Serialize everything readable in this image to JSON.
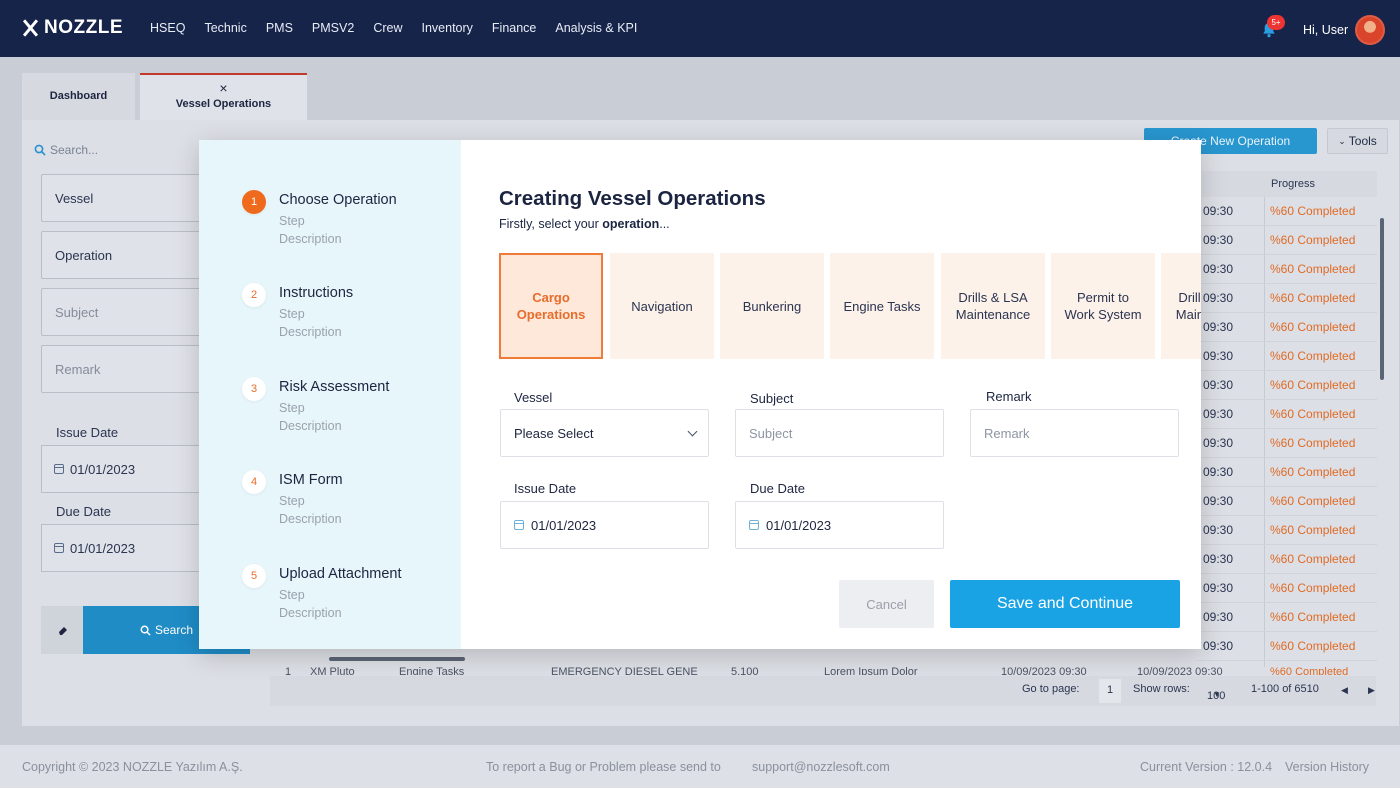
{
  "app": {
    "brand": "NOZZLE",
    "nav_items": [
      "HSEQ",
      "Technic",
      "PMS",
      "PMSV2",
      "Crew",
      "Inventory",
      "Finance",
      "Analysis & KPI"
    ],
    "notification_badge": "5+",
    "greeting": "Hi, User"
  },
  "tabs": {
    "dashboard": "Dashboard",
    "vessel_operations": "Vessel Operations",
    "close_glyph": "×"
  },
  "filters": {
    "search_placeholder": "Search...",
    "vessel": "Vessel",
    "operation": "Operation",
    "subject": "Subject",
    "remark": "Remark",
    "issue_date_label": "Issue Date",
    "issue_date": "01/01/2023",
    "due_date_label": "Due Date",
    "due_date": "01/01/2023",
    "search_button": "Search"
  },
  "toolbar": {
    "create_button": "Create New Operation",
    "tools_button": "Tools"
  },
  "table": {
    "progress_header": "Progress",
    "rows": [
      {
        "time": "09:30",
        "progress": "%60 Completed"
      },
      {
        "time": "09:30",
        "progress": "%60 Completed"
      },
      {
        "time": "09:30",
        "progress": "%60 Completed"
      },
      {
        "time": "09:30",
        "progress": "%60 Completed"
      },
      {
        "time": "09:30",
        "progress": "%60 Completed"
      },
      {
        "time": "09:30",
        "progress": "%60 Completed"
      },
      {
        "time": "09:30",
        "progress": "%60 Completed"
      },
      {
        "time": "09:30",
        "progress": "%60 Completed"
      },
      {
        "time": "09:30",
        "progress": "%60 Completed"
      },
      {
        "time": "09:30",
        "progress": "%60 Completed"
      },
      {
        "time": "09:30",
        "progress": "%60 Completed"
      },
      {
        "time": "09:30",
        "progress": "%60 Completed"
      },
      {
        "time": "09:30",
        "progress": "%60 Completed"
      },
      {
        "time": "09:30",
        "progress": "%60 Completed"
      },
      {
        "time": "09:30",
        "progress": "%60 Completed"
      },
      {
        "time": "09:30",
        "progress": "%60 Completed"
      }
    ],
    "partial_row": {
      "index": "1",
      "vessel": "XM Pluto",
      "operation": "Engine Tasks",
      "subject": "EMERGENCY DIESEL GENE",
      "code": "5.100",
      "remark": "Lorem Ipsum Dolor",
      "issue": "10/09/2023 09:30",
      "due": "10/09/2023 09:30",
      "progress": "%60 Completed"
    }
  },
  "pager": {
    "go_to_label": "Go to page:",
    "page": "1",
    "show_rows_label": "Show rows:",
    "rows_value": "100",
    "range": "1-100 of 6510"
  },
  "footer": {
    "copyright": "Copyright © 2023  NOZZLE Yazılım A.Ş.",
    "bug_report": "To report a Bug or Problem please send to",
    "email": "support@nozzlesoft.com",
    "version": "Current Version : 12.0.4",
    "history": "Version History"
  },
  "modal": {
    "title": "Creating Vessel Operations",
    "subtitle_prefix": "Firstly, select your ",
    "subtitle_bold": "operation",
    "subtitle_suffix": "...",
    "steps": [
      {
        "num": "1",
        "title": "Choose Operation",
        "sub": "Step",
        "desc": "Description"
      },
      {
        "num": "2",
        "title": "Instructions",
        "sub": "Step",
        "desc": "Description"
      },
      {
        "num": "3",
        "title": "Risk Assessment",
        "sub": "Step",
        "desc": "Description"
      },
      {
        "num": "4",
        "title": "ISM Form",
        "sub": "Step",
        "desc": "Description"
      },
      {
        "num": "5",
        "title": "Upload Attachment",
        "sub": "Step",
        "desc": "Description"
      }
    ],
    "operations": [
      {
        "line1": "Cargo",
        "line2": "Operations"
      },
      {
        "line1": "Navigation",
        "line2": ""
      },
      {
        "line1": "Bunkering",
        "line2": ""
      },
      {
        "line1": "Engine Tasks",
        "line2": ""
      },
      {
        "line1": "Drills & LSA",
        "line2": "Maintenance"
      },
      {
        "line1": "Permit to",
        "line2": "Work System"
      },
      {
        "line1": "Drills & LSA",
        "line2": "Maintenance"
      }
    ],
    "form": {
      "vessel_label": "Vessel",
      "vessel_value": "Please Select",
      "subject_label": "Subject",
      "subject_placeholder": "Subject",
      "remark_label": "Remark",
      "remark_placeholder": "Remark",
      "issue_label": "Issue Date",
      "issue_value": "01/01/2023",
      "due_label": "Due Date",
      "due_value": "01/01/2023"
    },
    "cancel": "Cancel",
    "save": "Save and Continue"
  }
}
